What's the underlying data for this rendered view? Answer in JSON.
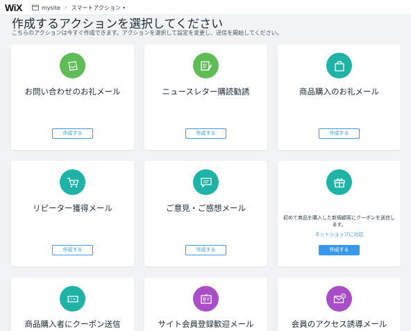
{
  "topbar": {
    "logo": "WiX",
    "site_name": "mysite",
    "separator": "›",
    "section": "スマートアクション",
    "caret": "▾"
  },
  "page": {
    "title": "作成するアクションを選択してください",
    "subtitle": "こちらのアクションは今すぐ作成できます。アクションを選択して設定を変更し、送信を開始してください。"
  },
  "cards": [
    {
      "name": "お問い合わせのお礼メール",
      "button": "作成する",
      "icon": "thank-you-note-icon",
      "color": "#60bc57"
    },
    {
      "name": "ニュースレター購読勧誘",
      "button": "作成する",
      "icon": "newsletter-pen-icon",
      "color": "#60bc57"
    },
    {
      "name": "商品購入のお礼メール",
      "button": "作成する",
      "icon": "shopping-bag-icon",
      "color": "#1eb3a6"
    },
    {
      "name": "リピーター獲得メール",
      "button": "作成する",
      "icon": "shopping-cart-icon",
      "color": "#1eb3a6"
    },
    {
      "name": "ご意見・ご感想メール",
      "button": "作成する",
      "icon": "chat-bubble-icon",
      "color": "#1eb3a6"
    },
    {
      "description": "初めて商品を購入した新規顧客にクーポンを送信します。",
      "link": "ネットショップに対応",
      "button": "作成する",
      "icon": "gift-box-icon",
      "color": "#1eb3a6"
    },
    {
      "name": "商品購入者にクーポン送信",
      "icon": "coupon-ticket-icon",
      "color": "#1eb3a6"
    },
    {
      "name": "サイト会員登録歓迎メール",
      "icon": "member-card-icon",
      "color": "#aa4dc8"
    },
    {
      "name": "会員のアクセス誘導メール",
      "icon": "email-envelope-icon",
      "color": "#aa4dc8"
    }
  ]
}
